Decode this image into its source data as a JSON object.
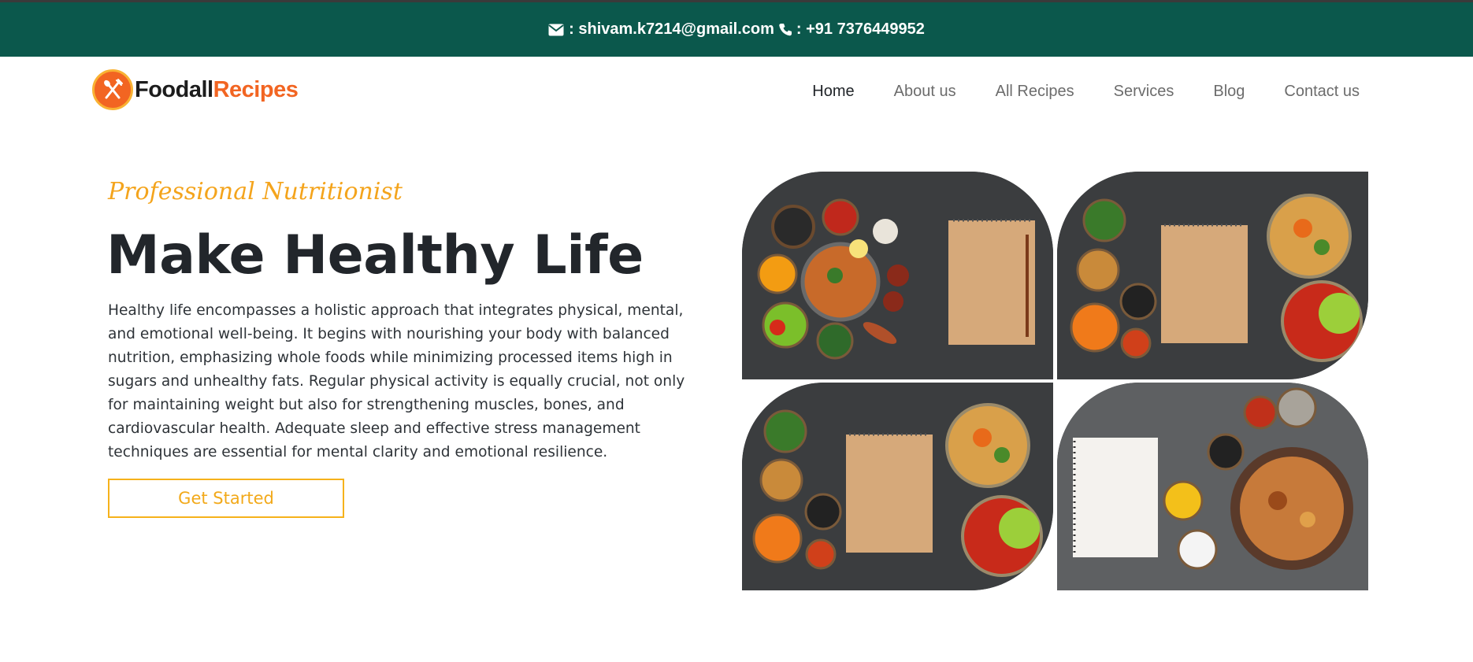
{
  "topbar": {
    "email": ": shivam.k7214@gmail.com",
    "phone": ": +91 7376449952",
    "email_icon": "envelope-icon",
    "phone_icon": "phone-icon"
  },
  "brand": {
    "name_part1": "Foodall",
    "name_part2": "Recipes",
    "logo_icon": "fork-spoon-icon",
    "colors": {
      "accent": "#f26522",
      "dark": "#1c1c1c"
    }
  },
  "nav": {
    "items": [
      {
        "label": "Home",
        "active": true
      },
      {
        "label": "About us",
        "active": false
      },
      {
        "label": "All Recipes",
        "active": false
      },
      {
        "label": "Services",
        "active": false
      },
      {
        "label": "Blog",
        "active": false
      },
      {
        "label": "Contact us",
        "active": false
      }
    ]
  },
  "hero": {
    "eyebrow": "Professional Nutritionist",
    "title": "Make Healthy Life",
    "description": "Healthy life encompasses a holistic approach that integrates physical, mental, and emotional well-being. It begins with nourishing your body with balanced nutrition, emphasizing whole foods while minimizing processed items high in sugars and unhealthy fats. Regular physical activity is equally crucial, not only for maintaining weight but also for strengthening muscles, bones, and cardiovascular health. Adequate sleep and effective stress management techniques are essential for mental clarity and emotional resilience.",
    "cta_label": "Get Started"
  },
  "colors": {
    "topbar_bg": "#0b584c",
    "eyebrow": "#f4a41c",
    "cta_border": "#f6b21b"
  },
  "gallery": {
    "images": [
      {
        "name": "spices-and-notepad-image"
      },
      {
        "name": "salad-and-notepad-image"
      },
      {
        "name": "veggies-and-notepad-image"
      },
      {
        "name": "stew-and-notebook-image"
      }
    ]
  }
}
